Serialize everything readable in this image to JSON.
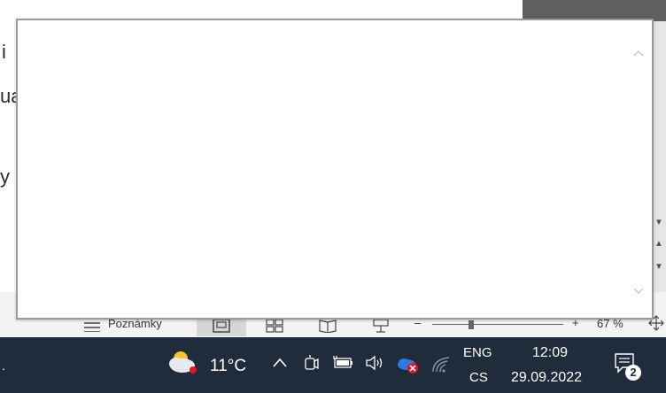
{
  "document": {
    "fragments": [
      "i",
      "ua",
      "y"
    ]
  },
  "word_status": {
    "notes_label": "Poznámky",
    "zoom_minus": "–",
    "zoom_plus": "+",
    "zoom_level": "67 %",
    "zoom_fraction": 0.3
  },
  "popup": {
    "content": ""
  },
  "taskbar": {
    "weather_temp": "11°C",
    "language_primary": "ENG",
    "language_secondary": "CS",
    "time": "12:09",
    "date": "29.09.2022",
    "notification_count": "2",
    "left_stub": "."
  },
  "colors": {
    "taskbar_bg": "#202b3b",
    "onedrive_error": "#e81123",
    "weather_dot": "#e81123"
  }
}
